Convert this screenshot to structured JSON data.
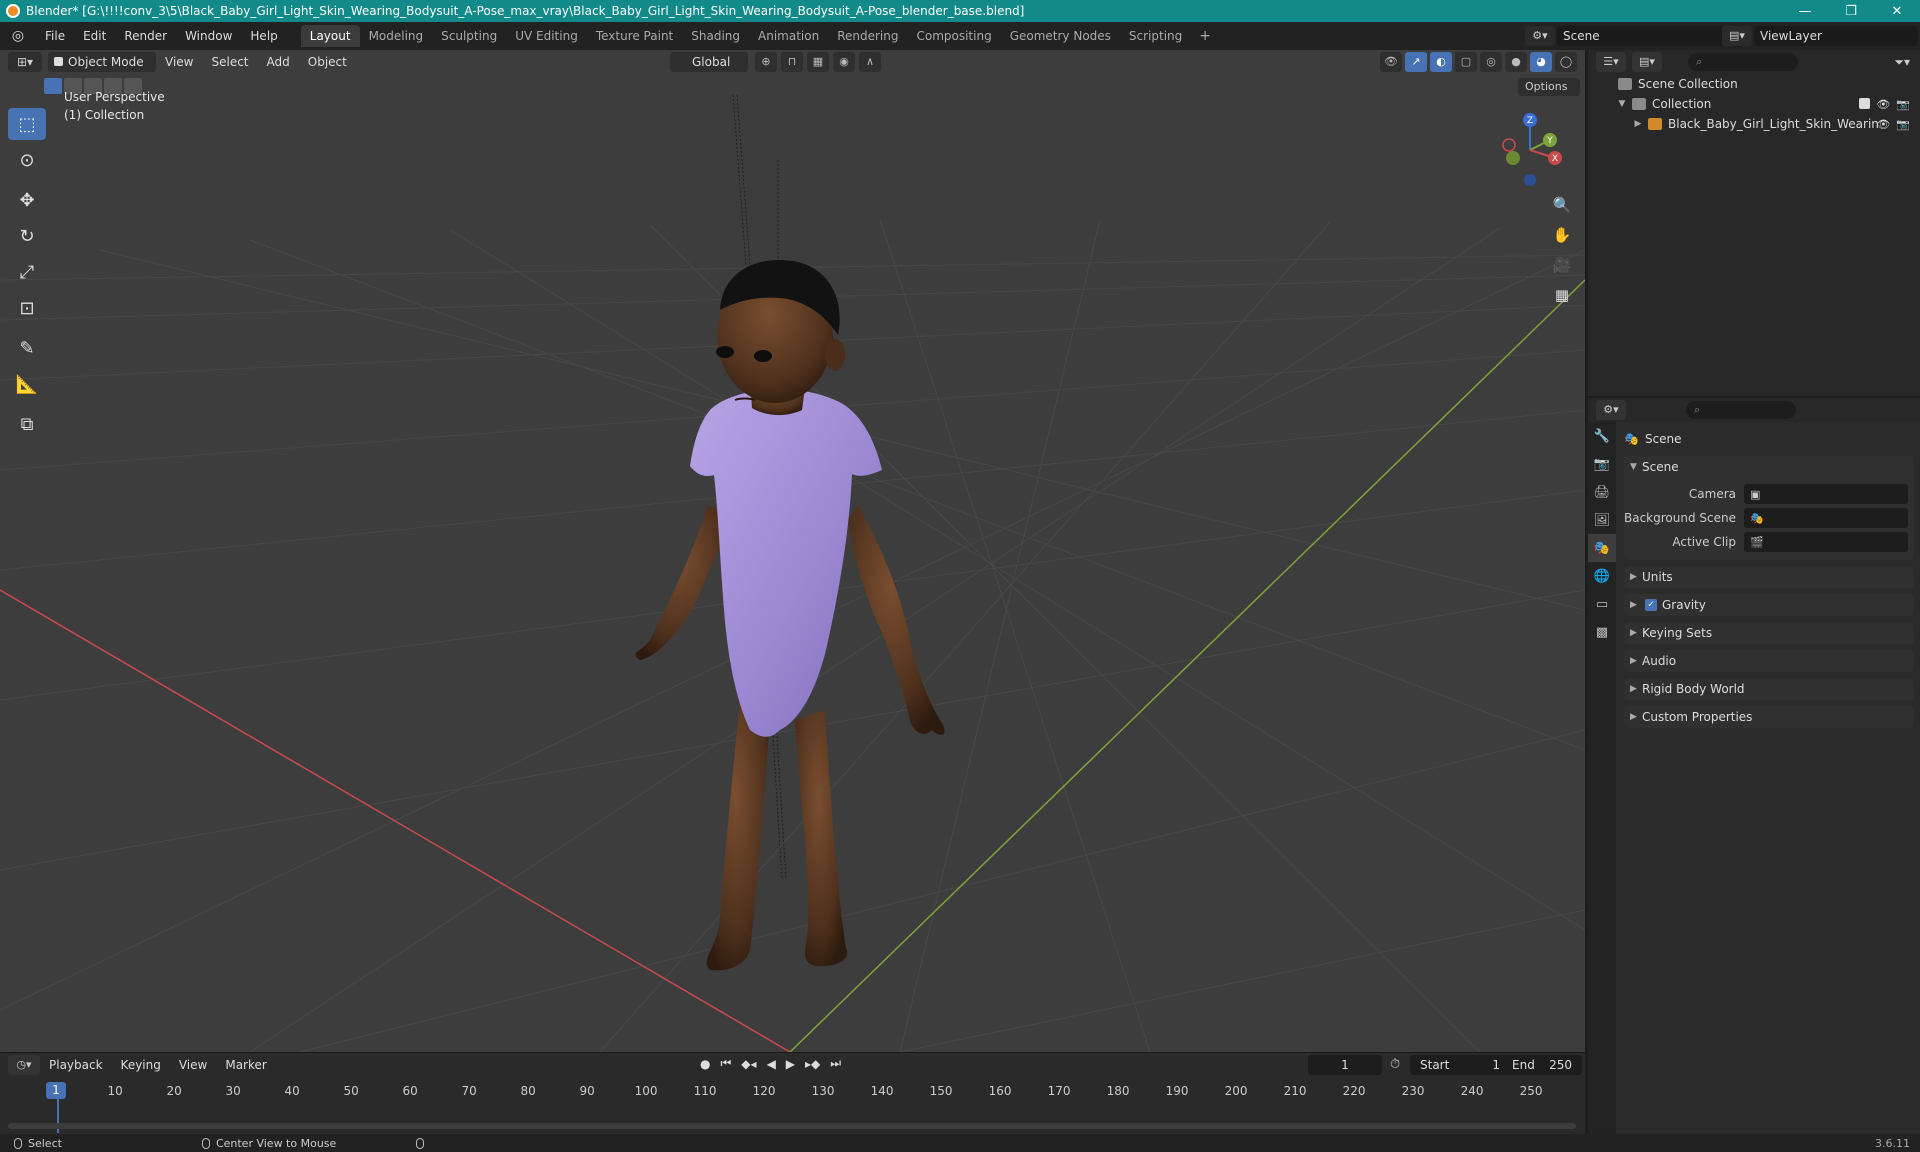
{
  "window": {
    "title": "Blender* [G:\\!!!!conv_3\\5\\Black_Baby_Girl_Light_Skin_Wearing_Bodysuit_A-Pose_max_vray\\Black_Baby_Girl_Light_Skin_Wearing_Bodysuit_A-Pose_blender_base.blend]",
    "minimize": "—",
    "maximize": "❐",
    "close": "✕"
  },
  "menu": [
    "File",
    "Edit",
    "Render",
    "Window",
    "Help"
  ],
  "workspaces": [
    "Layout",
    "Modeling",
    "Sculpting",
    "UV Editing",
    "Texture Paint",
    "Shading",
    "Animation",
    "Rendering",
    "Compositing",
    "Geometry Nodes",
    "Scripting"
  ],
  "active_workspace": "Layout",
  "scene_name": "Scene",
  "view_layer": "ViewLayer",
  "viewport": {
    "mode": "Object Mode",
    "menus": [
      "View",
      "Select",
      "Add",
      "Object"
    ],
    "orientation": "Global",
    "options_label": "Options",
    "info_line1": "User Perspective",
    "info_line2": "(1) Collection",
    "gizmo": {
      "z": "Z",
      "y": "Y",
      "x": "X"
    }
  },
  "timeline": {
    "menus": [
      "Playback",
      "Keying",
      "View",
      "Marker"
    ],
    "current_frame": "1",
    "start_label": "Start",
    "start_value": "1",
    "end_label": "End",
    "end_value": "250",
    "ticks": [
      "1",
      "10",
      "20",
      "30",
      "40",
      "50",
      "60",
      "70",
      "80",
      "90",
      "100",
      "110",
      "120",
      "130",
      "140",
      "150",
      "160",
      "170",
      "180",
      "190",
      "200",
      "210",
      "220",
      "230",
      "240",
      "250"
    ]
  },
  "statusbar": {
    "select": "Select",
    "center_view": "Center View to Mouse",
    "version": "3.6.11"
  },
  "outliner": {
    "root": "Scene Collection",
    "collection": "Collection",
    "object": "Black_Baby_Girl_Light_Skin_Wearin"
  },
  "properties": {
    "context": "Scene",
    "scene_panel": "Scene",
    "camera_label": "Camera",
    "bg_scene_label": "Background Scene",
    "active_clip_label": "Active Clip",
    "panels": [
      "Units",
      "Gravity",
      "Keying Sets",
      "Audio",
      "Rigid Body World",
      "Custom Properties"
    ]
  },
  "colors": {
    "title_bar": "#128a8a",
    "accent": "#4772b3",
    "axis_x": "#c94a4a",
    "axis_y": "#7ea33a",
    "bodysuit": "#a48fd6",
    "skin": "#5b3a24"
  }
}
